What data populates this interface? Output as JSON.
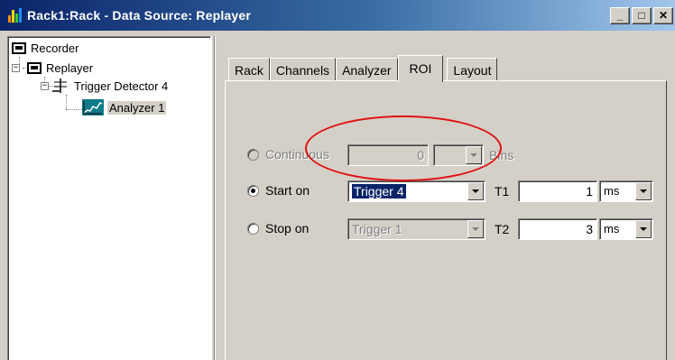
{
  "window": {
    "title": "Rack1:Rack - Data Source: Replayer",
    "buttons": {
      "minimize": "_",
      "maximize": "□",
      "close": "✕"
    }
  },
  "tree": {
    "items": [
      {
        "label": "Recorder",
        "icon": "device-icon"
      },
      {
        "label": "Replayer",
        "icon": "device-icon",
        "expander": "−"
      },
      {
        "label": "Trigger Detector 4",
        "icon": "trigger-icon",
        "expander": "−"
      },
      {
        "label": "Analyzer 1",
        "icon": "analyzer-icon",
        "selected": true
      }
    ]
  },
  "tabs": [
    {
      "label": "Rack"
    },
    {
      "label": "Channels"
    },
    {
      "label": "Analyzer"
    },
    {
      "label": "ROI",
      "active": true
    },
    {
      "label": "Layout"
    }
  ],
  "roi": {
    "continuous": {
      "label": "Continuous",
      "value": "0",
      "unit_label": "Bins",
      "checked": false,
      "enabled": false
    },
    "start_on": {
      "label": "Start on",
      "trigger": "Trigger 4",
      "t_label": "T1",
      "t_value": "1",
      "t_unit": "ms",
      "checked": true
    },
    "stop_on": {
      "label": "Stop on",
      "trigger": "Trigger 1",
      "t_label": "T2",
      "t_value": "3",
      "t_unit": "ms",
      "checked": false
    }
  },
  "colors": {
    "titlebar_start": "#0a246a",
    "titlebar_end": "#a6caf0",
    "annotation": "#e01010"
  }
}
